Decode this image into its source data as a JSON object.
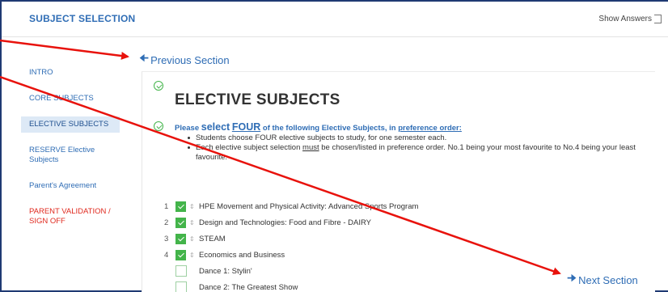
{
  "header": {
    "title": "SUBJECT SELECTION",
    "show_answers": "Show Answers"
  },
  "nav": {
    "previous": "Previous Section",
    "next": "Next Section"
  },
  "sidebar": {
    "items": [
      {
        "label": "INTRO"
      },
      {
        "label": "CORE SUBJECTS"
      },
      {
        "label": "ELECTIVE SUBJECTS"
      },
      {
        "label": "RESERVE Elective Subjects"
      },
      {
        "label": "Parent's Agreement"
      },
      {
        "label": "PARENT VALIDATION / SIGN OFF"
      }
    ]
  },
  "main": {
    "title": "ELECTIVE SUBJECTS",
    "instruction": {
      "p1": "Please ",
      "select": "select",
      "p2": " ",
      "four": "FOUR",
      "p3": " of the following Elective Subjects, in ",
      "pref": "preference order:"
    },
    "bullets": {
      "b1": "Students choose FOUR elective subjects to study, for one semester each.",
      "b2_a": "Each elective subject selection ",
      "b2_must": "must",
      "b2_b": " be chosen/listed in preference order.  No.1 being your most favourite to No.4 being your least favourite."
    },
    "subjects": [
      {
        "num": "1",
        "label": "HPE Movement and Physical Activity: Advanced Sports Program",
        "checked": true
      },
      {
        "num": "2",
        "label": "Design and Technologies: Food and Fibre - DAIRY",
        "checked": true
      },
      {
        "num": "3",
        "label": "STEAM",
        "checked": true
      },
      {
        "num": "4",
        "label": "Economics and Business",
        "checked": true
      },
      {
        "num": "",
        "label": "Dance 1: Stylin'",
        "checked": false
      },
      {
        "num": "",
        "label": "Dance 2: The Greatest Show",
        "checked": false
      }
    ]
  },
  "colors": {
    "accent": "#2f6db5",
    "check": "#43b44a",
    "warning": "#e0291e",
    "annotation_arrow": "#e8120c"
  }
}
